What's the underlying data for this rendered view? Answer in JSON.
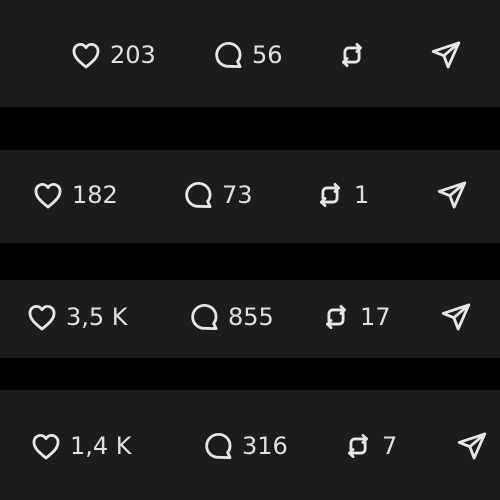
{
  "colors": {
    "background": "#000000",
    "bar": "#1c1c1c",
    "icon": "#e6e6e6",
    "text": "#e0e0e0"
  },
  "posts": [
    {
      "likes": "203",
      "comments": "56",
      "reposts": "",
      "icons": [
        "heart-icon",
        "comment-icon",
        "repost-icon",
        "send-icon"
      ]
    },
    {
      "likes": "182",
      "comments": "73",
      "reposts": "1",
      "icons": [
        "heart-icon",
        "comment-icon",
        "repost-icon",
        "send-icon"
      ]
    },
    {
      "likes": "3,5 K",
      "comments": "855",
      "reposts": "17",
      "icons": [
        "heart-icon",
        "comment-icon",
        "repost-icon",
        "send-icon"
      ]
    },
    {
      "likes": "1,4 K",
      "comments": "316",
      "reposts": "7",
      "icons": [
        "heart-icon",
        "comment-icon",
        "repost-icon",
        "send-icon"
      ]
    }
  ]
}
